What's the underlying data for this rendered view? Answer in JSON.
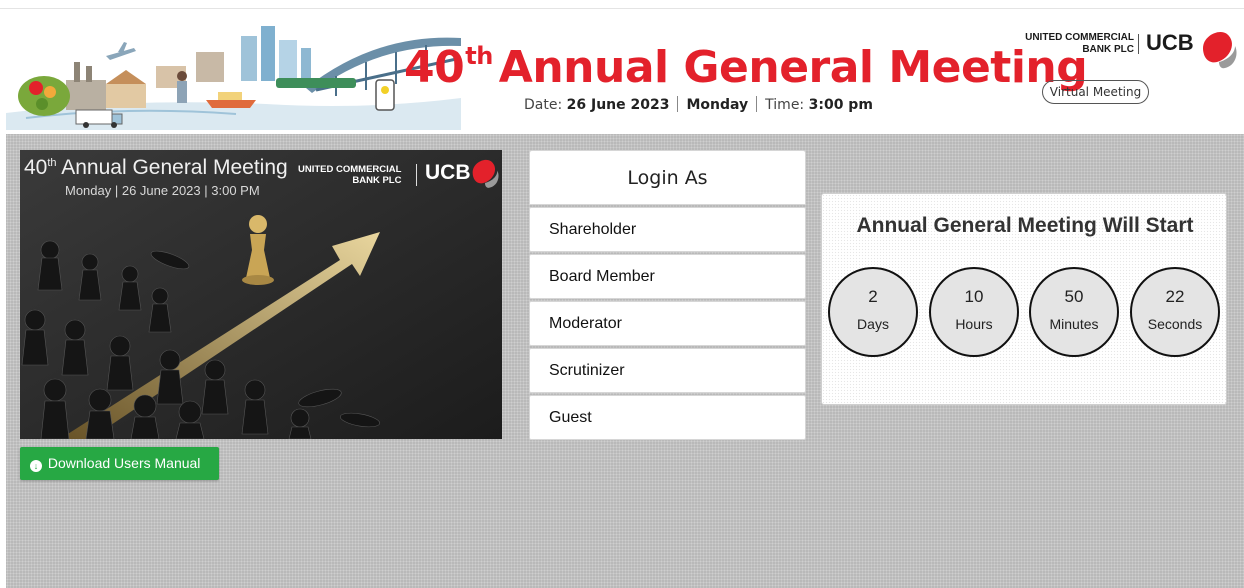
{
  "header": {
    "title_main": "40",
    "title_sup": "th",
    "title_rest": "Annual General Meeting",
    "date_label": "Date:",
    "date_value": "26 June 2023",
    "day": "Monday",
    "time_label": "Time:",
    "time_value": "3:00 pm",
    "bank_line1": "UNITED COMMERCIAL",
    "bank_line2": "BANK PLC",
    "bank_mark": "UCB",
    "virtual_label": "Virtual Meeting",
    "accent_color": "#e3212b"
  },
  "poster": {
    "title_num": "40",
    "title_sup": "th",
    "title_rest": " Annual General Meeting",
    "subtitle": "Monday | 26 June 2023 | 3:00 PM",
    "bank_line1": "UNITED COMMERCIAL",
    "bank_line2": "BANK PLC",
    "bank_mark": "UCB"
  },
  "download": {
    "icon": "download-circle-icon",
    "label": "Download Users Manual",
    "color": "#27a844"
  },
  "login": {
    "heading": "Login As",
    "options": [
      "Shareholder",
      "Board Member",
      "Moderator",
      "Scrutinizer",
      "Guest"
    ]
  },
  "countdown": {
    "title": "Annual General Meeting Will Start",
    "units": [
      {
        "value": "2",
        "label": "Days"
      },
      {
        "value": "10",
        "label": "Hours"
      },
      {
        "value": "50",
        "label": "Minutes"
      },
      {
        "value": "22",
        "label": "Seconds"
      }
    ]
  }
}
